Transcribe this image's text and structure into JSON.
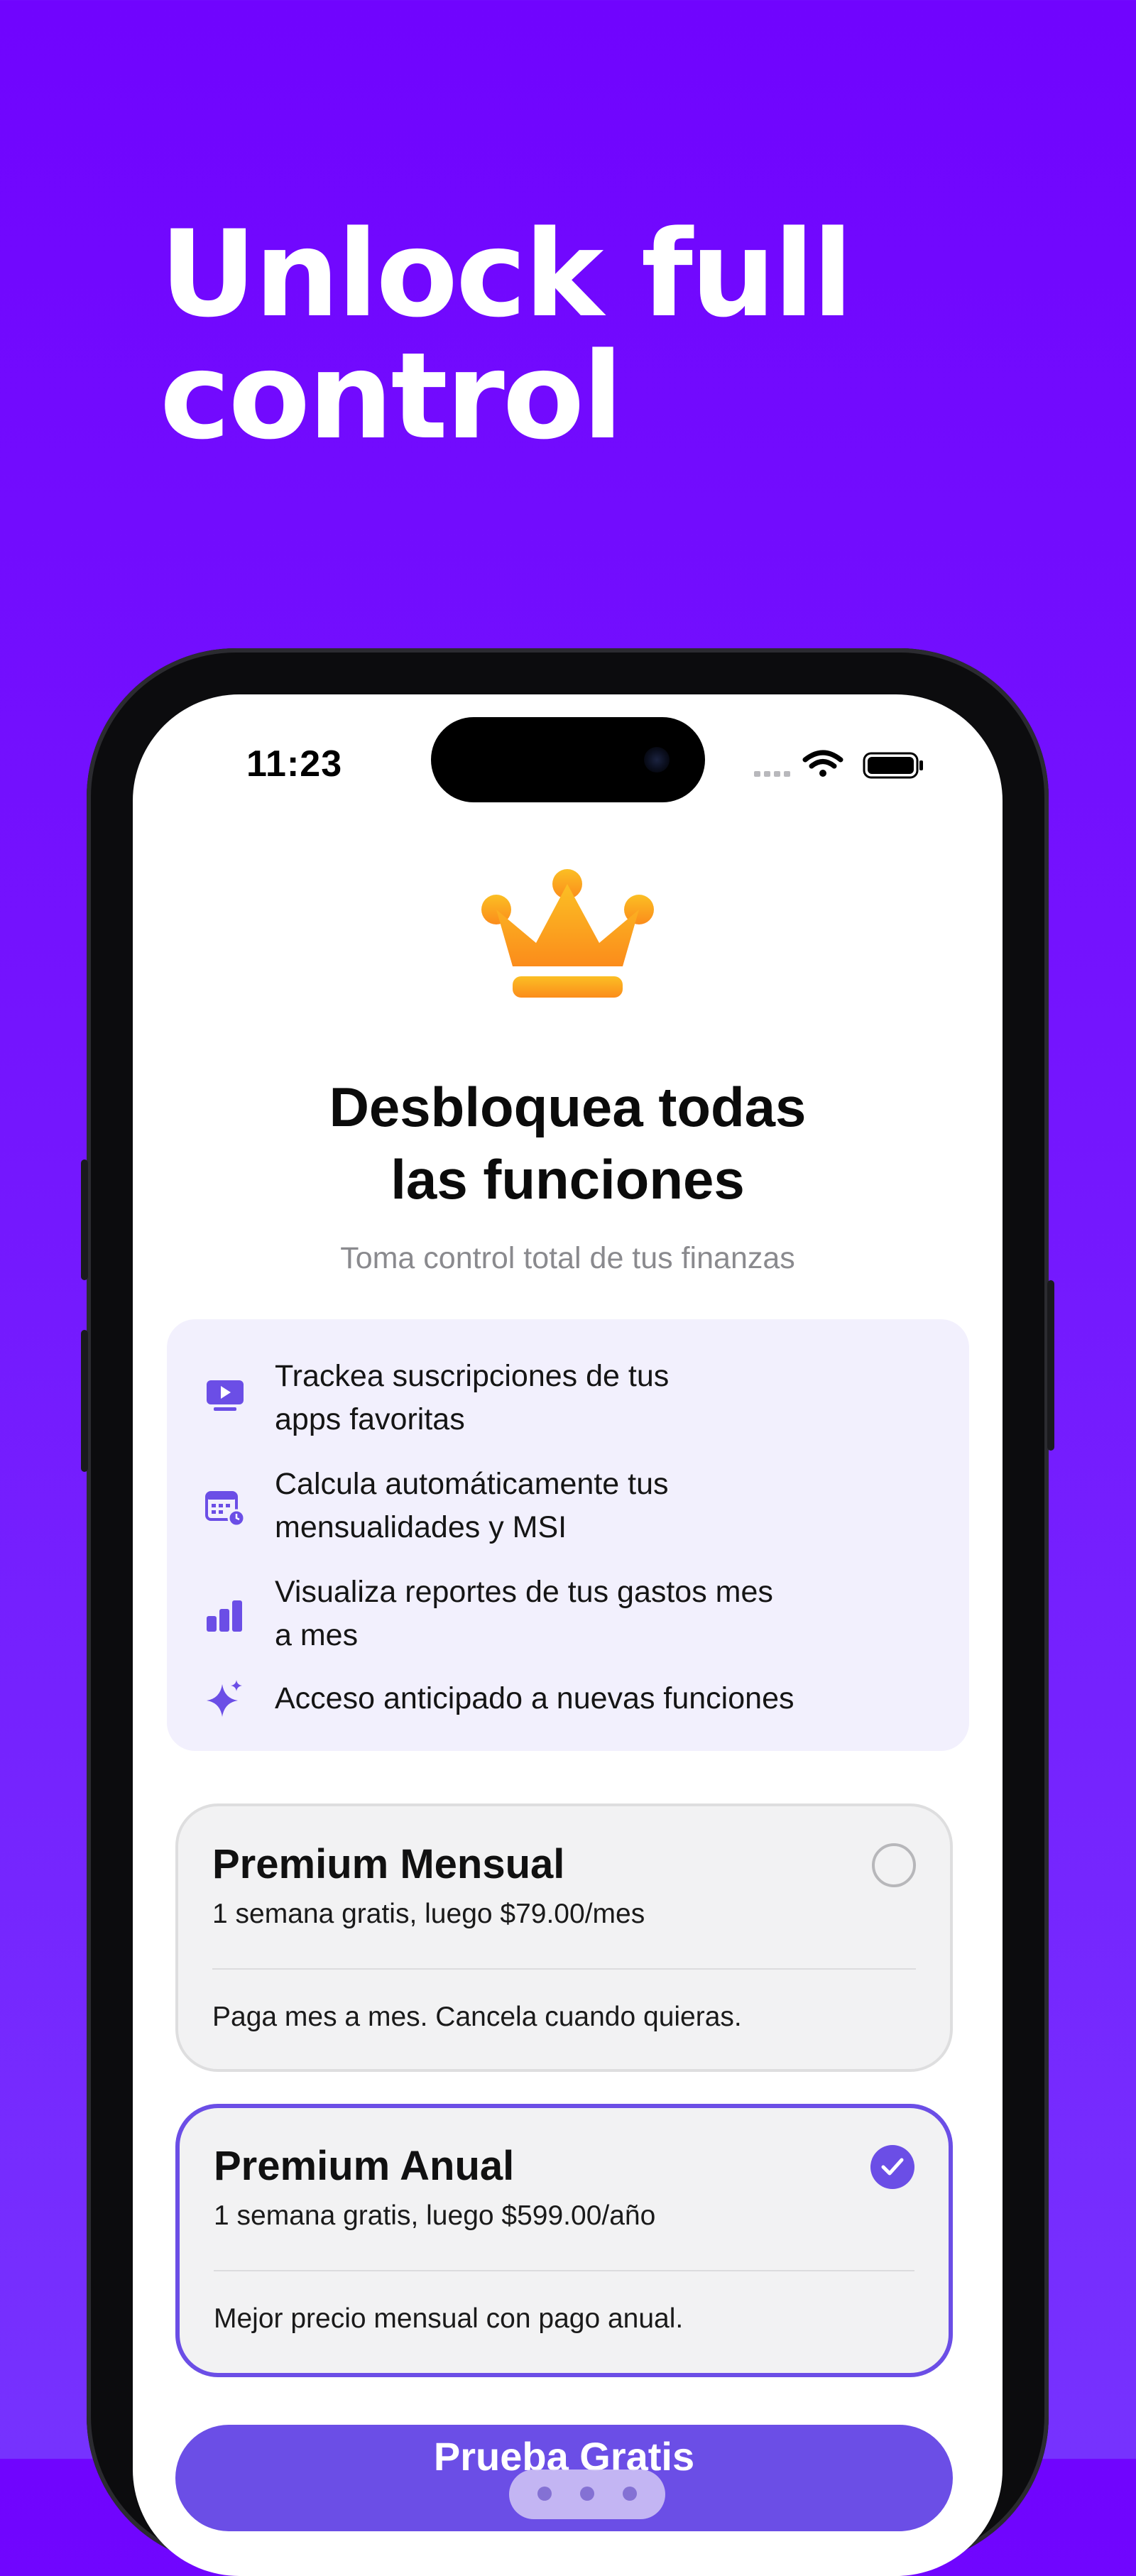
{
  "hero": {
    "line1": "Unlock full",
    "line2": "control"
  },
  "status_bar": {
    "time": "11:23"
  },
  "paywall": {
    "title_line1": "Desbloquea todas",
    "title_line2": "las funciones",
    "subtitle": "Toma control total de tus finanzas",
    "features": [
      {
        "icon": "play-video-icon",
        "line1": "Trackea suscripciones de tus",
        "line2": "apps favoritas"
      },
      {
        "icon": "calendar-clock-icon",
        "line1": "Calcula automáticamente tus",
        "line2": "mensualidades y MSI"
      },
      {
        "icon": "bar-chart-icon",
        "line1": "Visualiza reportes de tus gastos mes",
        "line2": "a mes"
      },
      {
        "icon": "sparkles-icon",
        "line1": "Acceso anticipado a nuevas funciones",
        "line2": ""
      }
    ],
    "plans": [
      {
        "name": "Premium Mensual",
        "price": "1 semana gratis, luego $79.00/mes",
        "description": "Paga mes a mes. Cancela cuando quieras.",
        "selected": false
      },
      {
        "name": "Premium Anual",
        "price": "1 semana gratis, luego $599.00/año",
        "description": "Mejor precio mensual con pago anual.",
        "selected": true
      }
    ],
    "cta_label": "Prueba Gratis"
  },
  "colors": {
    "background": "#7413FE",
    "accent": "#6B4EE6",
    "crown": "#FBA91B",
    "feature_panel": "#F2F0FD"
  }
}
